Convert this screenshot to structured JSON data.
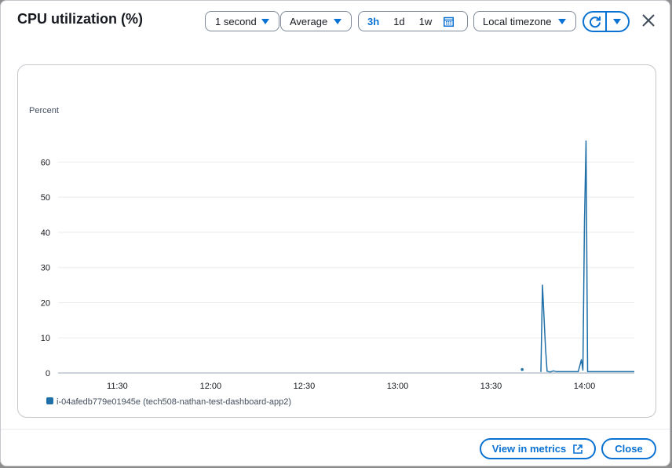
{
  "title": "CPU utilization (%)",
  "controls": {
    "period": "1 second",
    "statistic": "Average",
    "ranges": [
      "3h",
      "1d",
      "1w"
    ],
    "active_range": "3h",
    "timezone": "Local timezone"
  },
  "footer": {
    "view_in_metrics": "View in metrics",
    "close": "Close"
  },
  "colors": {
    "accent": "#0972d3",
    "series": "#1f6fa8"
  },
  "icons": [
    "calendar-icon",
    "refresh-icon",
    "caret-down-icon",
    "close-icon",
    "external-link-icon"
  ],
  "chart_data": {
    "type": "line",
    "ylabel": "Percent",
    "ylim": [
      0,
      65
    ],
    "yticks": [
      0,
      10,
      20,
      30,
      40,
      50,
      60
    ],
    "xticks": [
      "11:30",
      "12:00",
      "12:30",
      "13:00",
      "13:30",
      "14:00"
    ],
    "xrange": [
      "11:11",
      "14:16"
    ],
    "grid": true,
    "legend_position": "bottom-left",
    "series": [
      {
        "name": "i-04afedb779e01945e (tech508-nathan-test-dashboard-app2)",
        "isolated_points": [
          {
            "x": "13:40",
            "y": 1
          }
        ],
        "points": [
          {
            "x": "13:46",
            "y": 0.3
          },
          {
            "x": "13:46:30",
            "y": 25
          },
          {
            "x": "13:47:30",
            "y": 7
          },
          {
            "x": "13:48",
            "y": 0.5
          },
          {
            "x": "13:49",
            "y": 0.3
          },
          {
            "x": "13:50",
            "y": 0.6
          },
          {
            "x": "13:51",
            "y": 0.4
          },
          {
            "x": "13:58",
            "y": 0.4
          },
          {
            "x": "13:59",
            "y": 3.8
          },
          {
            "x": "13:59:30",
            "y": 0.8
          },
          {
            "x": "14:00",
            "y": 43
          },
          {
            "x": "14:00:30",
            "y": 66
          },
          {
            "x": "14:01",
            "y": 0.4
          },
          {
            "x": "14:16",
            "y": 0.4
          }
        ]
      }
    ]
  }
}
